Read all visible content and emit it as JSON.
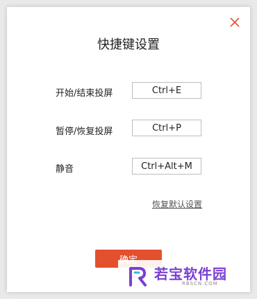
{
  "dialog": {
    "title": "快捷键设置",
    "close_icon": "close-icon"
  },
  "shortcuts": [
    {
      "label": "开始/结束投屏",
      "value": "Ctrl+E"
    },
    {
      "label": "暂停/恢复投屏",
      "value": "Ctrl+P"
    },
    {
      "label": "静音",
      "value": "Ctrl+Alt+M"
    }
  ],
  "reset_label": "恢复默认设置",
  "confirm_label": "确定",
  "watermark": {
    "name": "若宝软件园",
    "site": "RBSCN.COM"
  },
  "colors": {
    "accent": "#e2502e",
    "close": "#e2502e",
    "watermark": "#7a3fd1"
  }
}
